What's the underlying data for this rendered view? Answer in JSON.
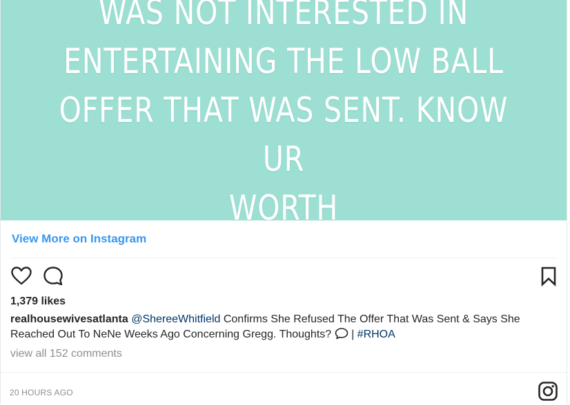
{
  "media": {
    "text_lines": [
      "WAS NOT INTERESTED IN",
      "ENTERTAINING THE LOW BALL",
      "OFFER THAT WAS SENT. KNOW UR",
      "WORTH"
    ],
    "background_color": "#9ddfd3"
  },
  "view_more_label": "View More on Instagram",
  "actions": {
    "like_icon": "heart-icon",
    "comment_icon": "comment-icon",
    "save_icon": "bookmark-icon"
  },
  "likes_text": "1,379 likes",
  "caption": {
    "username": "realhousewivesatlanta",
    "mention": "@ShereeWhitfield",
    "text": " Confirms She Refused The Offer That Was Sent & Says She Reached Out To NeNe Weeks Ago Concerning Gregg. Thoughts? ",
    "separator": " | ",
    "hashtag": "#RHOA"
  },
  "comments_link": "view all 152 comments",
  "timestamp": "20 HOURS AGO",
  "brand_icon": "instagram-icon",
  "colors": {
    "link": "#3897f0",
    "mention": "#003569",
    "muted": "#8e8e8e"
  }
}
